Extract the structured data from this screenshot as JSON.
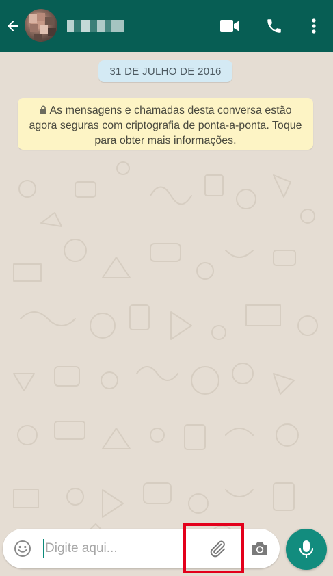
{
  "header": {
    "contact_name": "▪▪▪ ▪▪▪",
    "background": "#075e54",
    "icons": [
      "back-arrow-icon",
      "video-call-icon",
      "phone-icon",
      "more-vert-icon"
    ]
  },
  "chat": {
    "date_label": "31 DE JULHO DE 2016",
    "encryption_notice": "As mensagens e chamadas desta conversa estão agora seguras com criptografia de ponta-a-ponta. Toque para obter mais informações.",
    "notice_background": "#fdf4c5",
    "date_background": "#d4eaf4"
  },
  "composer": {
    "placeholder": "Digite aqui...",
    "value": "",
    "icons": [
      "emoji-icon",
      "paperclip-icon",
      "camera-icon",
      "microphone-icon"
    ],
    "accent": "#128c7e",
    "highlight_color": "#e3001b"
  }
}
